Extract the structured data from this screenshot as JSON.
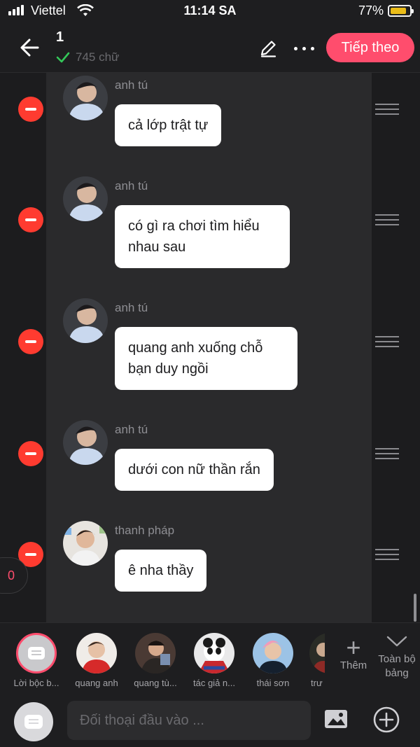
{
  "status_bar": {
    "carrier": "Viettel",
    "time": "11:14 SA",
    "battery": "77%"
  },
  "header": {
    "title": "1",
    "word_count": "745 chữ",
    "next_label": "Tiếp theo"
  },
  "messages": [
    {
      "author": "anh tú",
      "text": "cả lớp trật tự"
    },
    {
      "author": "anh tú",
      "text": "có gì ra chơi tìm hiểu nhau sau"
    },
    {
      "author": "anh tú",
      "text": "quang anh xuống chỗ bạn duy ngồi"
    },
    {
      "author": "anh tú",
      "text": "dưới con nữ thần rắn"
    },
    {
      "author": "thanh pháp",
      "text": "ê nha thầy"
    }
  ],
  "counter": "0",
  "characters": [
    {
      "name": "Lời bộc b..."
    },
    {
      "name": "quang anh"
    },
    {
      "name": "quang tù..."
    },
    {
      "name": "tác giả n..."
    },
    {
      "name": "thái sơn"
    },
    {
      "name": "trư"
    }
  ],
  "char_actions": {
    "more": "Thêm",
    "all": "Toàn bộ bảng"
  },
  "composer": {
    "placeholder": "Đối thoại đầu vào ..."
  },
  "colors": {
    "accent": "#ff4d6d",
    "delete": "#ff3b30",
    "background": "#1c1c1e",
    "panel": "#2a2a2c"
  },
  "icons": [
    "back-arrow-icon",
    "check-icon",
    "pencil-icon",
    "more-icon",
    "minus-icon",
    "drag-handle-icon",
    "plus-icon",
    "chevron-down-icon",
    "narration-icon",
    "image-icon",
    "add-circle-icon"
  ]
}
